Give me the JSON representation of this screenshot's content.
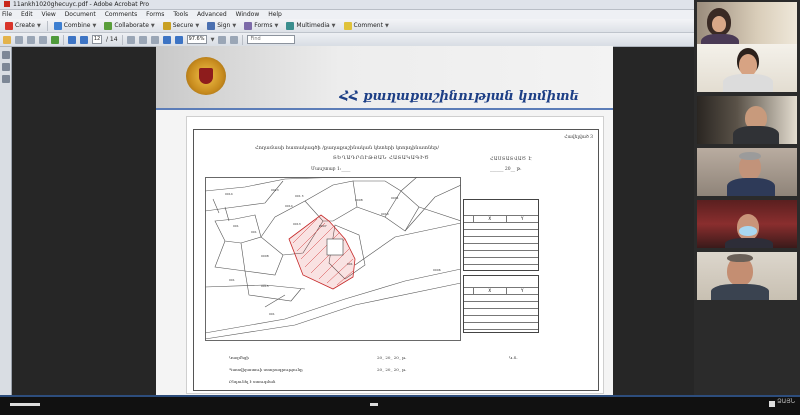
{
  "window": {
    "title": "11ankh1020ghecuyc.pdf - Adobe Acrobat Pro"
  },
  "menu": {
    "items": [
      "File",
      "Edit",
      "View",
      "Document",
      "Comments",
      "Forms",
      "Tools",
      "Advanced",
      "Window",
      "Help"
    ]
  },
  "toolbar1": {
    "create": "Create",
    "combine": "Combine",
    "collaborate": "Collaborate",
    "secure": "Secure",
    "sign": "Sign",
    "forms": "Forms",
    "multimedia": "Multimedia",
    "comment": "Comment"
  },
  "toolbar2": {
    "page_current": "12",
    "page_total": "/ 14",
    "zoom": "97.6%",
    "find_placeholder": "Find"
  },
  "slide": {
    "title": "ՀՀ քաղաքաշինության կոմիտե"
  },
  "sheet": {
    "header_right": "Հավելված 3",
    "title_line1": "Հողամասի հատակագծի /քաղաքաշինական կետերի կոորդինատներ/",
    "title_line2": "ՏԵՂԱԴՐՈՒԹՅԱՆ ՀԱՏԱԿԱԳԻԾ",
    "scale": "Մասշտաբ 1:____",
    "approve": "ՀԱՍՏԱՏՎԱԾ Է",
    "approve_date": "______ 20__ թ.",
    "footer1": "Կազմեցի",
    "footer1_date": "20_ 20_ 20_ թ.",
    "footer2": "Պատվիրատուի ստորագրությունը",
    "footer2_date": "20_ 20_ 20_ թ.",
    "footer3": "Ընդունել է ստուգման",
    "stamp": "Կ.Տ.",
    "table_col_x": "X",
    "table_col_y": "Y"
  },
  "bottom": {
    "label": "ՁԱՅՆ"
  }
}
